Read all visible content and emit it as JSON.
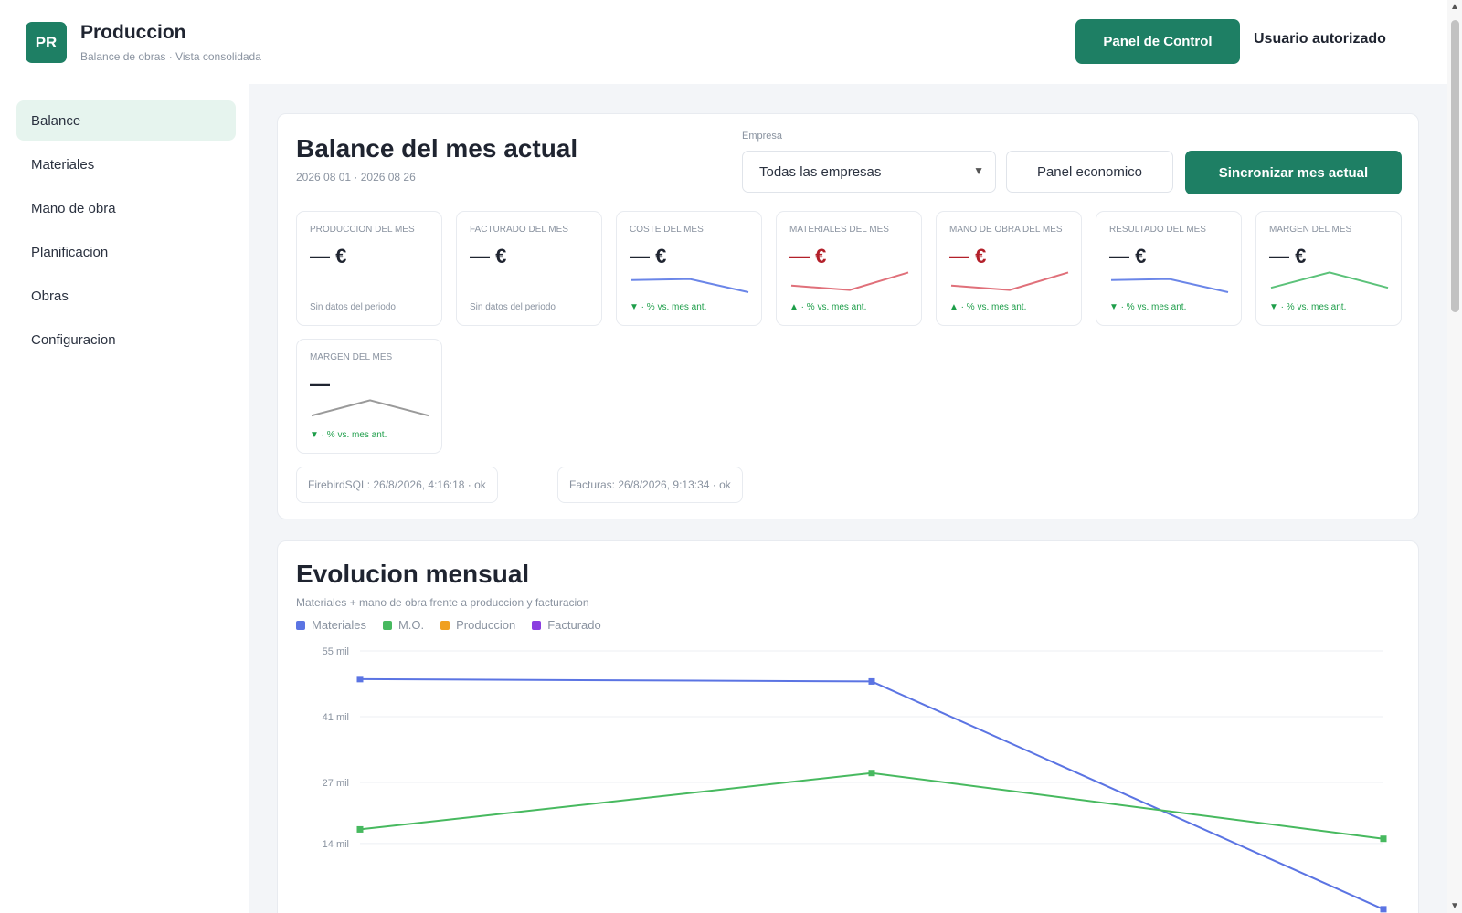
{
  "header": {
    "logo_text": "PR",
    "title": "Produccion",
    "subtitle": "Balance de obras · Vista consolidada",
    "control_button": "Panel de Control",
    "user": "Usuario autorizado"
  },
  "sidebar": {
    "items": [
      {
        "label": "Balance",
        "active": true
      },
      {
        "label": "Materiales",
        "active": false
      },
      {
        "label": "Mano de obra",
        "active": false
      },
      {
        "label": "Planificacion",
        "active": false
      },
      {
        "label": "Obras",
        "active": false
      },
      {
        "label": "Configuracion",
        "active": false
      }
    ]
  },
  "balance": {
    "title": "Balance del mes actual",
    "period": "2026 08 01 · 2026 08 26",
    "company_label": "Empresa",
    "company_value": "Todas las empresas",
    "economic_button": "Panel economico",
    "sync_button": "Sincronizar mes actual",
    "kpis": [
      {
        "label": "PRODUCCION DEL MES",
        "value": "— €",
        "foot": "Sin datos del periodo",
        "trend": "none",
        "color": "#1f2430",
        "foot_color": "#8a93a0",
        "spark_color": "",
        "spark": []
      },
      {
        "label": "FACTURADO DEL MES",
        "value": "— €",
        "foot": "Sin datos del periodo",
        "trend": "none",
        "color": "#1f2430",
        "foot_color": "#8a93a0",
        "spark_color": "",
        "spark": []
      },
      {
        "label": "COSTE DEL MES",
        "value": "— €",
        "foot": "▼ · % vs. mes ant.",
        "trend": "down",
        "color": "#1f2430",
        "foot_color": "#1e9e4a",
        "spark_color": "#6b86e8",
        "spark": [
          0.55,
          0.6,
          0.0
        ]
      },
      {
        "label": "MATERIALES DEL MES",
        "value": "— €",
        "foot": "▲ · % vs. mes ant.",
        "trend": "up",
        "color": "#b3202a",
        "foot_color": "#1e9e4a",
        "spark_color": "#e0707a",
        "spark": [
          0.3,
          0.1,
          0.9
        ]
      },
      {
        "label": "MANO DE OBRA DEL MES",
        "value": "— €",
        "foot": "▲ · % vs. mes ant.",
        "trend": "up",
        "color": "#b3202a",
        "foot_color": "#1e9e4a",
        "spark_color": "#e0707a",
        "spark": [
          0.3,
          0.1,
          0.9
        ]
      },
      {
        "label": "RESULTADO DEL MES",
        "value": "— €",
        "foot": "▼ · % vs. mes ant.",
        "trend": "down",
        "color": "#1f2430",
        "foot_color": "#1e9e4a",
        "spark_color": "#6b86e8",
        "spark": [
          0.55,
          0.6,
          0.0
        ]
      },
      {
        "label": "MARGEN DEL MES",
        "value": "— €",
        "foot": "▼ · % vs. mes ant.",
        "trend": "down",
        "color": "#1f2430",
        "foot_color": "#1e9e4a",
        "spark_color": "#5cc27a",
        "spark": [
          0.2,
          0.9,
          0.2
        ]
      },
      {
        "label": "MARGEN DEL MES",
        "value": "—",
        "foot": "▼ · % vs. mes ant.",
        "trend": "down",
        "color": "#1f2430",
        "foot_color": "#1e9e4a",
        "spark_color": "#9a9a9a",
        "spark": [
          0.2,
          0.9,
          0.2
        ]
      }
    ],
    "sync_chips": [
      "FirebirdSQL: 26/8/2026, 4:16:18 · ok",
      "Facturas: 26/8/2026, 9:13:34 · ok"
    ]
  },
  "evolution": {
    "title": "Evolucion mensual",
    "subtitle": "Materiales + mano de obra frente a produccion y facturacion"
  },
  "chart_data": {
    "type": "line",
    "legend": "top-left",
    "grid": true,
    "x": [
      "",
      "",
      ""
    ],
    "yticks": [
      "55 mil",
      "41 mil",
      "27 mil",
      "14 mil"
    ],
    "ytick_values": [
      55,
      41,
      27,
      14
    ],
    "ylim": [
      0,
      55
    ],
    "series": [
      {
        "name": "Materiales",
        "color": "#5b74e3",
        "values": [
          49,
          48.5,
          0
        ]
      },
      {
        "name": "M.O.",
        "color": "#47b95f",
        "values": [
          17,
          29,
          15
        ]
      },
      {
        "name": "Produccion",
        "color": "#f0a020",
        "values": []
      },
      {
        "name": "Facturado",
        "color": "#8a3ee0",
        "values": []
      }
    ]
  }
}
